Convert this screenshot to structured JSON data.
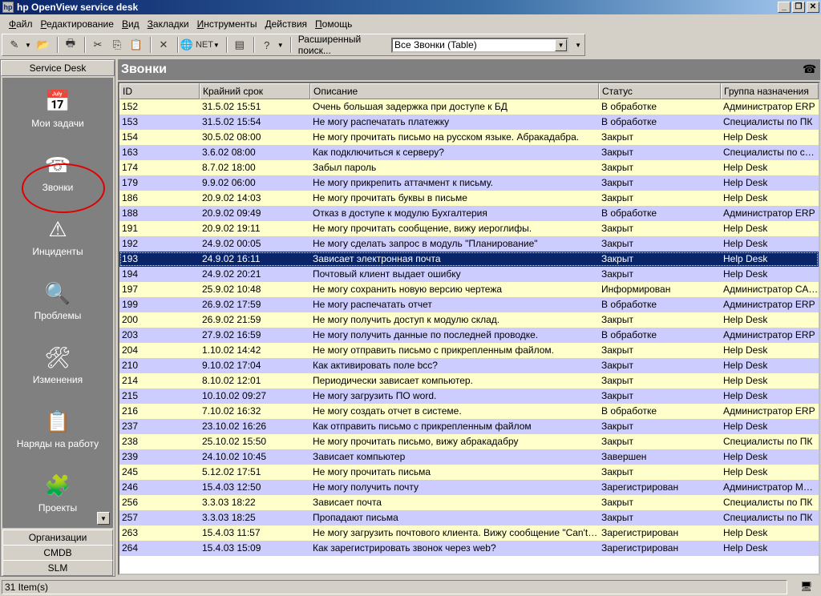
{
  "window": {
    "title": "hp OpenView service desk",
    "min": "_",
    "max": "❐",
    "close": "✕"
  },
  "menu": [
    "Файл",
    "Редактирование",
    "Вид",
    "Закладки",
    "Инструменты",
    "Действия",
    "Помощь"
  ],
  "toolbar": {
    "net_label": "NET",
    "search_label": "Расширенный поиск...",
    "search_value": "Все Звонки (Table)"
  },
  "sidebar": {
    "title": "Service Desk",
    "items": [
      {
        "label": "Мои задачи",
        "icon": "calendar-clock-icon",
        "glyph": "📅"
      },
      {
        "label": "Звонки",
        "icon": "phone-icon",
        "glyph": "☎"
      },
      {
        "label": "Инциденты",
        "icon": "incident-window-icon",
        "glyph": "⚠"
      },
      {
        "label": "Проблемы",
        "icon": "magnifier-icon",
        "glyph": "🔍"
      },
      {
        "label": "Изменения",
        "icon": "tools-icon",
        "glyph": "🛠"
      },
      {
        "label": "Наряды на работу",
        "icon": "checklist-icon",
        "glyph": "📋"
      },
      {
        "label": "Проекты",
        "icon": "puzzle-icon",
        "glyph": "🧩"
      }
    ],
    "bottom_tabs": [
      "Организации",
      "CMDB",
      "SLM"
    ]
  },
  "main": {
    "title": "Звонки",
    "columns": [
      "ID",
      "Крайний срок",
      "Описание",
      "Статус",
      "Группа назначения"
    ],
    "selected_row": 10,
    "rows": [
      [
        "152",
        "31.5.02 15:51",
        "Очень большая задержка при доступе к БД",
        "В обработке",
        "Администратор ERP"
      ],
      [
        "153",
        "31.5.02 15:54",
        "Не могу распечатать платежку",
        "В обработке",
        "Специалисты по ПК"
      ],
      [
        "154",
        "30.5.02 08:00",
        "Не могу прочитать письмо на русском языке. Абракадабра.",
        "Закрыт",
        "Help Desk"
      ],
      [
        "163",
        "3.6.02 08:00",
        "Как подключиться к серверу?",
        "Закрыт",
        "Специалисты по серв..."
      ],
      [
        "174",
        "8.7.02 18:00",
        "Забыл пароль",
        "Закрыт",
        "Help Desk"
      ],
      [
        "179",
        "9.9.02 06:00",
        "Не могу прикрепить аттачмент к письму.",
        "Закрыт",
        "Help Desk"
      ],
      [
        "186",
        "20.9.02 14:03",
        "Не могу прочитать буквы в письме",
        "Закрыт",
        "Help Desk"
      ],
      [
        "188",
        "20.9.02 09:49",
        "Отказ в доступе к модулю Бухгалтерия",
        "В обработке",
        "Администратор ERP"
      ],
      [
        "191",
        "20.9.02 19:11",
        "Не могу прочитать сообщение, вижу иероглифы.",
        "Закрыт",
        "Help Desk"
      ],
      [
        "192",
        "24.9.02 00:05",
        "Не могу сделать запрос в модуль \"Планирование\"",
        "Закрыт",
        "Help Desk"
      ],
      [
        "193",
        "24.9.02 16:11",
        "Зависает электронная почта",
        "Закрыт",
        "Help Desk"
      ],
      [
        "194",
        "24.9.02 20:21",
        "Почтовый клиент выдает ошибку",
        "Закрыт",
        "Help Desk"
      ],
      [
        "197",
        "25.9.02 10:48",
        "Не могу сохранить новую версию чертежа",
        "Информирован",
        "Администратор САПР"
      ],
      [
        "199",
        "26.9.02 17:59",
        "Не могу распечатать отчет",
        "В обработке",
        "Администратор ERP"
      ],
      [
        "200",
        "26.9.02 21:59",
        "Не могу получить доступ к модулю склад.",
        "Закрыт",
        "Help Desk"
      ],
      [
        "203",
        "27.9.02 16:59",
        "Не могу получить данные по последней проводке.",
        "В обработке",
        "Администратор ERP"
      ],
      [
        "204",
        "1.10.02 14:42",
        "Не могу отправить письмо с прикрепленным файлом.",
        "Закрыт",
        "Help Desk"
      ],
      [
        "210",
        "9.10.02 17:04",
        "Как активировать поле bcc?",
        "Закрыт",
        "Help Desk"
      ],
      [
        "214",
        "8.10.02 12:01",
        "Периодически зависает компьютер.",
        "Закрыт",
        "Help Desk"
      ],
      [
        "215",
        "10.10.02 09:27",
        "Не могу загрузить ПО word.",
        "Закрыт",
        "Help Desk"
      ],
      [
        "216",
        "7.10.02 16:32",
        "Не могу создать отчет в системе.",
        "В обработке",
        "Администратор ERP"
      ],
      [
        "237",
        "23.10.02 16:26",
        "Как отправить письмо с прикрепленным файлом",
        "Закрыт",
        "Help Desk"
      ],
      [
        "238",
        "25.10.02 15:50",
        "Не могу прочитать письмо, вижу абракадабру",
        "Закрыт",
        "Специалисты по ПК"
      ],
      [
        "239",
        "24.10.02 10:45",
        "Зависает компьютер",
        "Завершен",
        "Help Desk"
      ],
      [
        "245",
        "5.12.02 17:51",
        "Не могу прочитать письма",
        "Закрыт",
        "Help Desk"
      ],
      [
        "246",
        "15.4.03 12:50",
        "Не могу получить почту",
        "Зарегистрирован",
        "Администратор MS E..."
      ],
      [
        "256",
        "3.3.03 18:22",
        "Зависает почта",
        "Закрыт",
        "Специалисты по ПК"
      ],
      [
        "257",
        "3.3.03 18:25",
        "Пропадают письма",
        "Закрыт",
        "Специалисты по ПК"
      ],
      [
        "263",
        "15.4.03 11:57",
        "Не могу загрузить почтового клиента. Вижу сообщение \"Can't conn...",
        "Зарегистрирован",
        "Help Desk"
      ],
      [
        "264",
        "15.4.03 15:09",
        "Как зарегистрировать звонок через web?",
        "Зарегистрирован",
        "Help Desk"
      ]
    ]
  },
  "status": {
    "count": "31 Item(s)"
  },
  "colors": {
    "row_a": "#ffffcc",
    "row_b": "#ccccff",
    "selected": "#0a246a",
    "annotation": "#e00000"
  }
}
